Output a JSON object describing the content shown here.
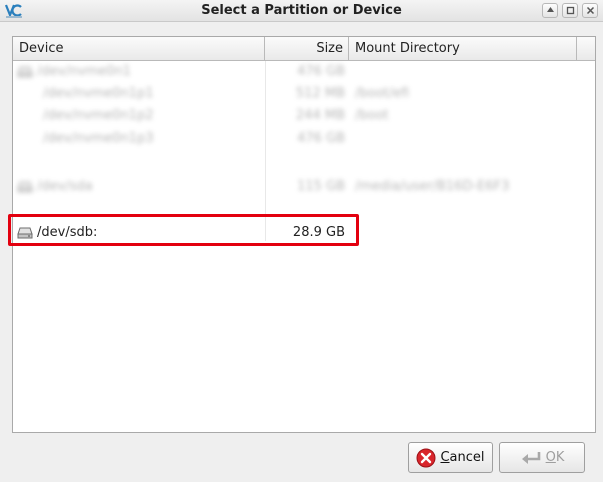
{
  "window": {
    "title": "Select a Partition or Device",
    "logo_icon": "vc-app-logo"
  },
  "columns": {
    "device": "Device",
    "size": "Size",
    "mount": "Mount Directory"
  },
  "rows": [
    {
      "device": "/dev/nvme0n1",
      "size": "476 GB",
      "mount": "",
      "blurred": true,
      "level": 0,
      "icon": "drive-icon"
    },
    {
      "device": "/dev/nvme0n1p1",
      "size": "512 MB",
      "mount": "/boot/efi",
      "blurred": true,
      "level": 1
    },
    {
      "device": "/dev/nvme0n1p2",
      "size": "244 MB",
      "mount": "/boot",
      "blurred": true,
      "level": 1
    },
    {
      "device": "/dev/nvme0n1p3",
      "size": "476 GB",
      "mount": "",
      "blurred": true,
      "level": 1
    },
    {
      "device": "/dev/sda",
      "size": "115 GB",
      "mount": "/media/user/B16D-E6F3",
      "blurred": true,
      "level": 0,
      "icon": "drive-icon"
    },
    {
      "device": "/dev/sdb:",
      "size": "28.9 GB",
      "mount": "",
      "blurred": false,
      "level": 0,
      "icon": "drive-icon",
      "highlighted": true
    }
  ],
  "buttons": {
    "cancel_mnemonic": "C",
    "cancel_rest": "ancel",
    "ok_mnemonic": "O",
    "ok_rest": "K",
    "ok_enabled": false
  },
  "colors": {
    "highlight_border": "#e3000f",
    "cancel_icon": "#d9262c"
  }
}
